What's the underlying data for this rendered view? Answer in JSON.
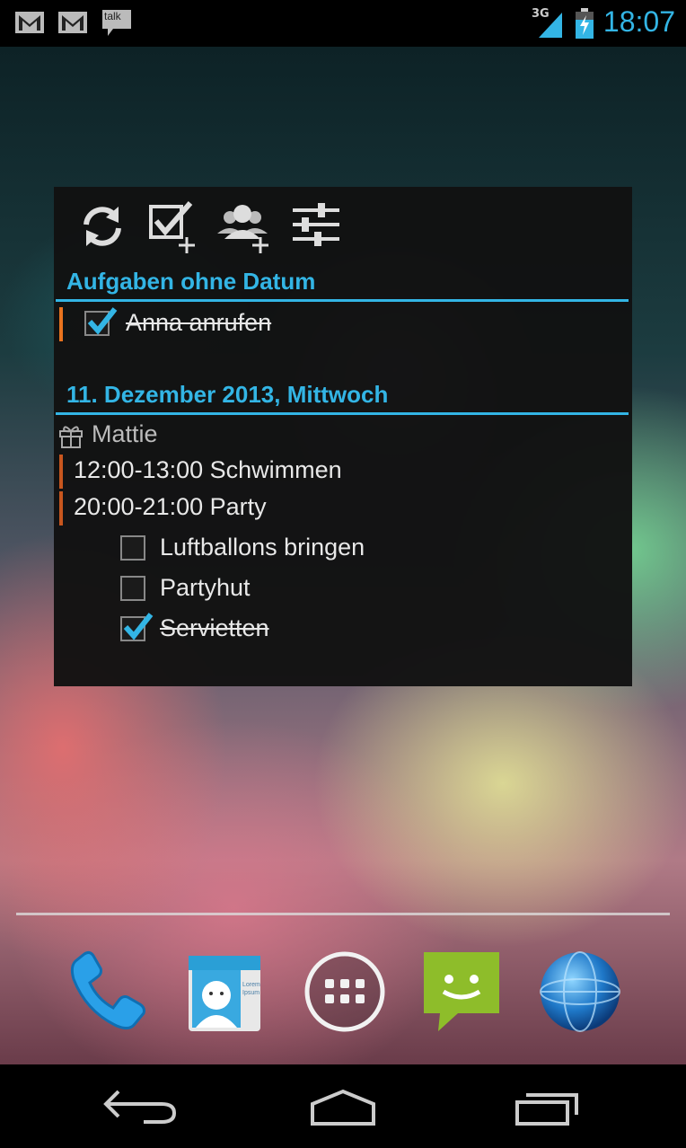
{
  "status_bar": {
    "time": "18:07",
    "network": "3G",
    "talk_label": "talk",
    "notifications": [
      "gmail-icon",
      "gmail-icon",
      "talk-icon"
    ]
  },
  "widget": {
    "toolbar": [
      "refresh-icon",
      "add-task-icon",
      "add-contact-icon",
      "settings-sliders-icon"
    ],
    "section_undated": {
      "title": "Aufgaben ohne Datum",
      "tasks": [
        {
          "label": "Anna anrufen",
          "checked": true,
          "color": "#e8731e"
        }
      ]
    },
    "section_dated": {
      "title": "11. Dezember 2013, Mittwoch",
      "birthday": "Mattie",
      "events": [
        {
          "label": "12:00-13:00 Schwimmen",
          "color": "#c8561e"
        },
        {
          "label": "20:00-21:00 Party",
          "color": "#c8561e"
        }
      ],
      "subtasks": [
        {
          "label": "Luftballons bringen",
          "checked": false
        },
        {
          "label": "Partyhut",
          "checked": false
        },
        {
          "label": "Servietten",
          "checked": true
        }
      ]
    }
  },
  "dock": [
    "phone-icon",
    "contacts-icon",
    "app-drawer-icon",
    "messaging-icon",
    "browser-icon"
  ],
  "contacts_card_text": "Lorem Ipsum",
  "navbar": [
    "back-icon",
    "home-icon",
    "recent-apps-icon"
  ],
  "colors": {
    "accent": "#33b5e5",
    "check": "#33b5e5"
  }
}
